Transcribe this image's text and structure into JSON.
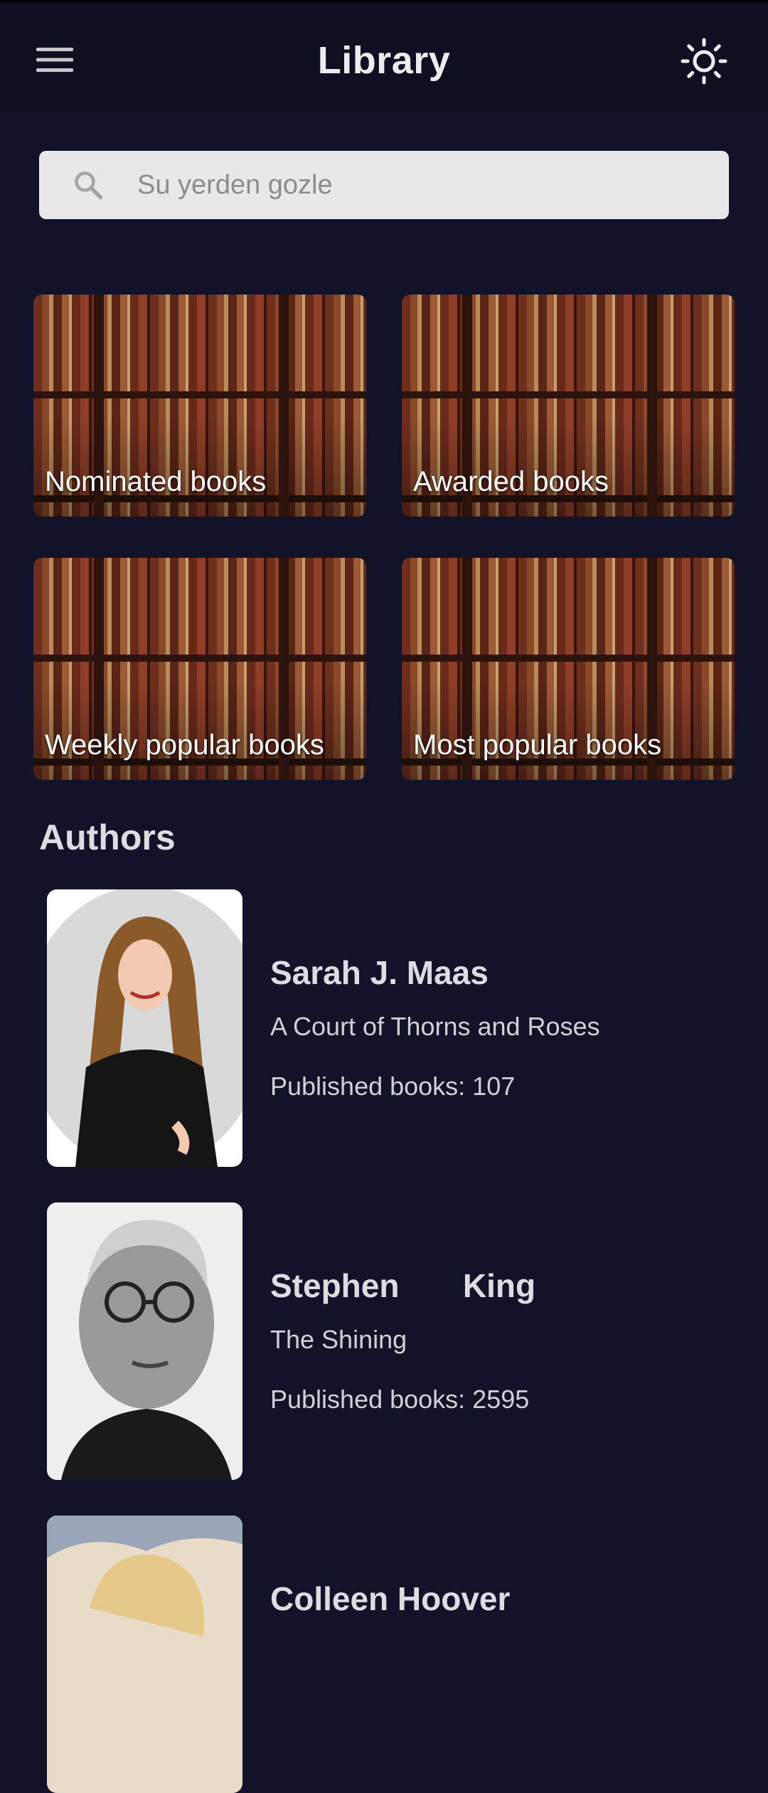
{
  "app_bar": {
    "title": "Library",
    "menu_icon": "menu-icon",
    "theme_icon": "sun-icon"
  },
  "search": {
    "placeholder": "Su yerden gozle",
    "value": "",
    "icon": "search-icon"
  },
  "categories": [
    {
      "label": "Nominated books"
    },
    {
      "label": "Awarded books"
    },
    {
      "label": "Weekly popular books"
    },
    {
      "label": "Most popular books"
    }
  ],
  "authors_section": {
    "title": "Authors"
  },
  "authors": [
    {
      "name": "Sarah J. Maas",
      "book": "A Court of Thorns and Roses",
      "published": "Published books: 107"
    },
    {
      "name": "Stephen       King",
      "book": "The Shining",
      "published": "Published books: 2595"
    },
    {
      "name": "Colleen Hoover",
      "book": "",
      "published": ""
    }
  ],
  "colors": {
    "background": "#121229",
    "app_bar": "#0f0f22",
    "search_bg": "#e8e8ea",
    "text": "#dcdce2"
  }
}
